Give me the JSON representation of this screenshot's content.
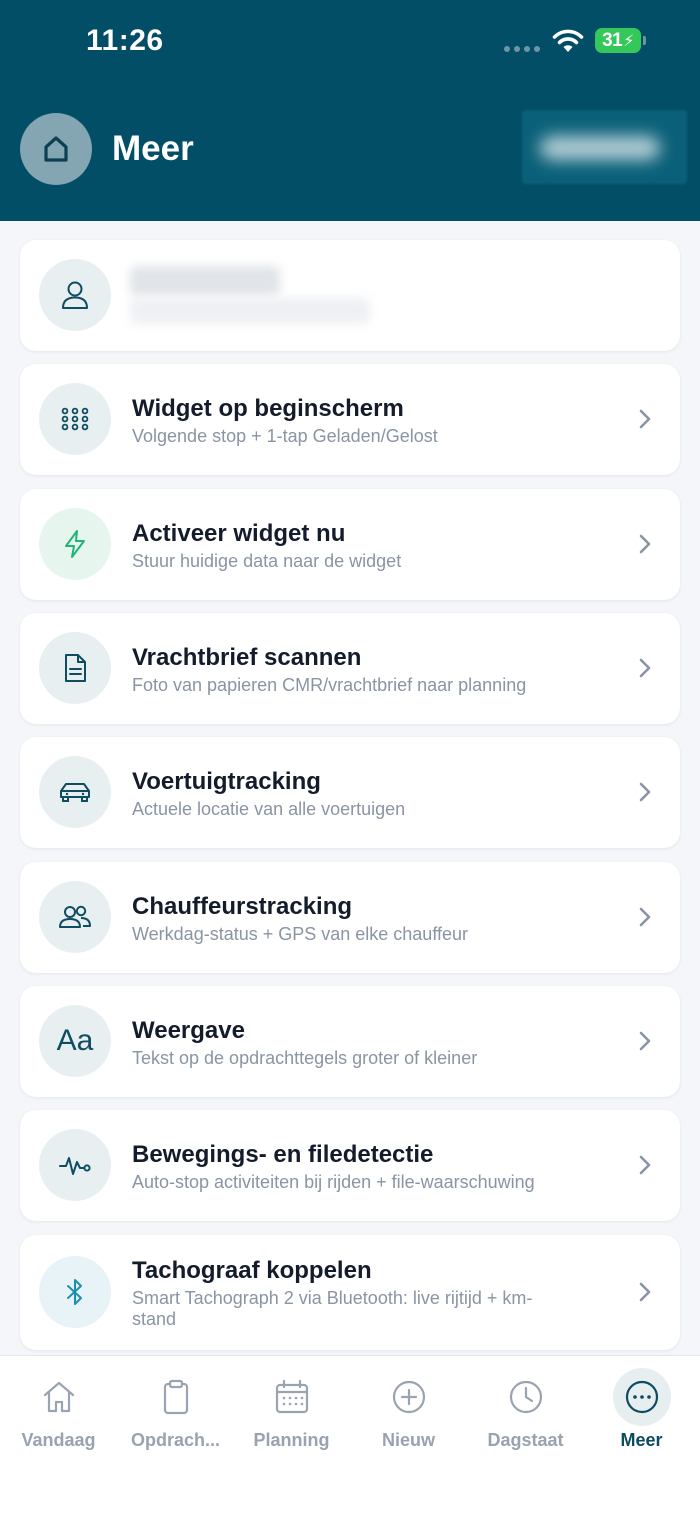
{
  "status_bar": {
    "time": "11:26",
    "battery": "31"
  },
  "header": {
    "title": "Meer",
    "icons": {
      "home": "home-icon"
    }
  },
  "menu": [
    {
      "title": "Widget op beginscherm",
      "subtitle": "Volgende stop + 1-tap Geladen/Gelost",
      "icon": "grid-dots-icon"
    },
    {
      "title": "Activeer widget nu",
      "subtitle": "Stuur huidige data naar de widget",
      "icon": "lightning-icon"
    },
    {
      "title": "Vrachtbrief scannen",
      "subtitle": "Foto van papieren CMR/vrachtbrief naar planning",
      "icon": "document-icon"
    },
    {
      "title": "Voertuigtracking",
      "subtitle": "Actuele locatie van alle voertuigen",
      "icon": "car-icon"
    },
    {
      "title": "Chauffeurstracking",
      "subtitle": "Werkdag-status + GPS van elke chauffeur",
      "icon": "users-icon"
    },
    {
      "title": "Weergave",
      "subtitle": "Tekst op de opdrachttegels groter of kleiner",
      "icon": "text-size-icon"
    },
    {
      "title": "Bewegings- en filedetectie",
      "subtitle": "Auto-stop activiteiten bij rijden + file-waarschuwing",
      "icon": "activity-icon"
    },
    {
      "title": "Tachograaf koppelen",
      "subtitle": "Smart Tachograph 2 via Bluetooth: live rijtijd + km-stand",
      "icon": "bluetooth-icon"
    }
  ],
  "tabs": [
    {
      "label": "Vandaag",
      "icon": "home-icon"
    },
    {
      "label": "Opdrach...",
      "icon": "clipboard-icon"
    },
    {
      "label": "Planning",
      "icon": "calendar-icon"
    },
    {
      "label": "Nieuw",
      "icon": "plus-circle-icon"
    },
    {
      "label": "Dagstaat",
      "icon": "clock-icon"
    },
    {
      "label": "Meer",
      "icon": "more-icon",
      "active": true
    }
  ],
  "colors": {
    "header": "#024e67",
    "accent": "#0d4b62",
    "green": "#20b37a",
    "battery": "#34c759"
  }
}
